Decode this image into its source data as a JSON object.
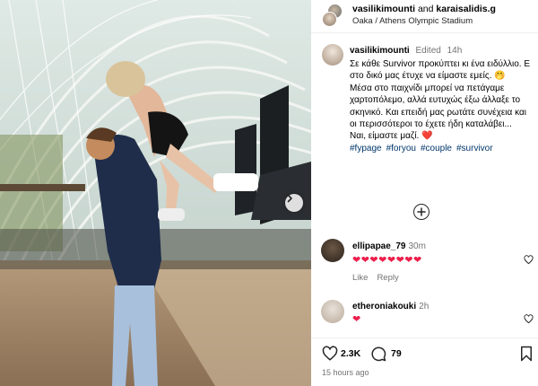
{
  "header": {
    "user1": "vasilikimounti",
    "joiner": "and",
    "user2": "karaisalidis.g",
    "location": "Oaka / Athens Olympic Stadium"
  },
  "caption": {
    "username": "vasilikimounti",
    "edited": "Edited",
    "time": "14h",
    "line1": "Σε κάθε Survivor προκύπτει κι ένα ειδύλλιο. Ε στο δικό μας έτυχε να είμαστε εμείς.",
    "emoji1": "🤭",
    "line2": "Μέσα στο παιχνίδι μπορεί να πετάγαμε χαρτοπόλεμο, αλλά ευτυχώς έξω άλλαξε το σκηνικό. Και επειδή μας ρωτάτε συνέχεια και οι περισσότεροι το έχετε ήδη καταλάβει...",
    "line3": "Ναι, είμαστε μαζί.",
    "emoji2": "❤️",
    "hashtags": [
      "#fypage",
      "#foryou",
      "#couple",
      "#survivor"
    ]
  },
  "comments": [
    {
      "username": "ellipapae_79",
      "time": "30m",
      "text": "❤❤❤❤❤❤❤❤",
      "like_label": "Like",
      "reply_label": "Reply"
    },
    {
      "username": "etheroniakouki",
      "time": "2h",
      "text": "❤"
    }
  ],
  "actions": {
    "likes": "2.3K",
    "comments": "79",
    "timestamp": "15 hours ago"
  },
  "colors": {
    "heart": "#ed1e4b",
    "hashtag": "#00376b",
    "muted": "#737373"
  },
  "icons": [
    "next-arrow-icon",
    "load-more-comments-icon",
    "heart-icon",
    "comment-icon",
    "bookmark-icon"
  ]
}
